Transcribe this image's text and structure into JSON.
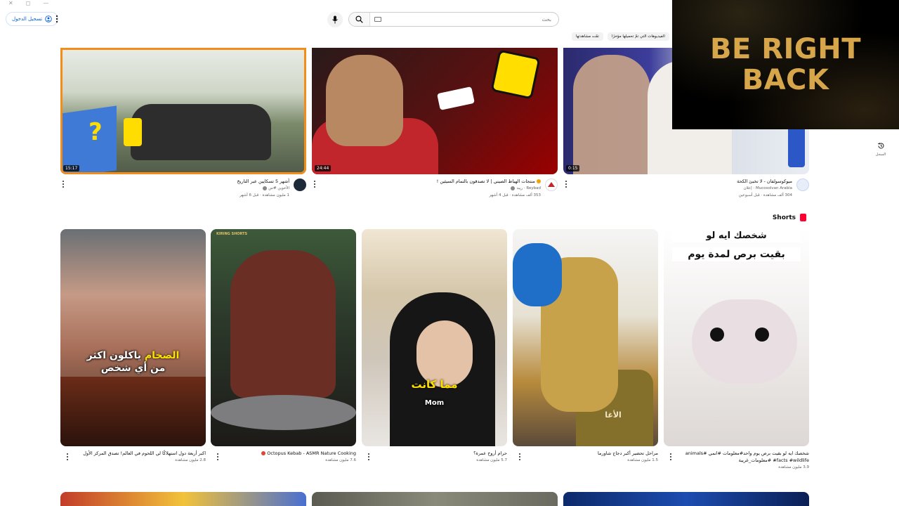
{
  "header": {
    "sign_in_label": "تسجيل الدخول",
    "search_placeholder": "بحث",
    "chips": [
      "الفيديوهات التي تمّ تحميلها مؤخرًا",
      "تمّت مشاهدتها"
    ]
  },
  "overlay": {
    "text": "BE RIGHT\nBACK"
  },
  "history": {
    "label": "السجل"
  },
  "videos": [
    {
      "duration": "15:17",
      "title": "أشهر 5 تسكايين عبر التاريخ",
      "channel": "الأخوين #س",
      "stats": "1 مليون مشاهدة · قبل 6 أشهر"
    },
    {
      "duration": "24:44",
      "title": "منتجات الهياط الصيني | لا تصدقون بالتمام السيئين !",
      "channel": "Reybad · ريبد",
      "stats": "353 ألف مشاهدة · قبل 4 أشهر"
    },
    {
      "duration": "0:15",
      "title": "ميوكوسولفان - لا تخبئ الكحة",
      "channel": "Mucosolvan Arabia · إعلان",
      "stats": "304 ألف مشاهدة · قبل أسبوعين"
    }
  ],
  "shorts": {
    "heading": "Shorts",
    "items": [
      {
        "title": "اكبر أربعة دول استهلاكًا لي اللحوم في العالم! تصدق المركز الأول",
        "stats": "2.8 مليون مشاهدة",
        "overlay_a": "الضخام",
        "overlay_b": "ياكلون اكثر",
        "overlay_c": "من أي شخص"
      },
      {
        "title": "Octopus Kebab - ASMR Nature Cooking",
        "stats": "7.6 مليون مشاهدة",
        "overlay_a": "KIRING SHORTS"
      },
      {
        "title": "حرام أروح عمرة؟",
        "stats": "5.7 مليون مشاهدة",
        "overlay_a": "مما كانت",
        "overlay_b": "Mom"
      },
      {
        "title": "مراحل تحضير أكبر دجاج شاورما",
        "stats": "1.5 مليون مشاهدة",
        "overlay_a": "الأغا"
      },
      {
        "title": "شخصك ايه لو بقيت برص يوم واحد#معلومات #انمي #animals #facts #wildlife #معلومات_غريبة",
        "stats": "3.9 مليون مشاهدة",
        "overlay_a": "شخصك ايه لو",
        "overlay_b": "بقيت برص لمدة يوم"
      }
    ]
  },
  "colors": {
    "accent": "#065fd4",
    "shorts_red": "#ff0033",
    "overlay_gold": "#d8a64a"
  }
}
